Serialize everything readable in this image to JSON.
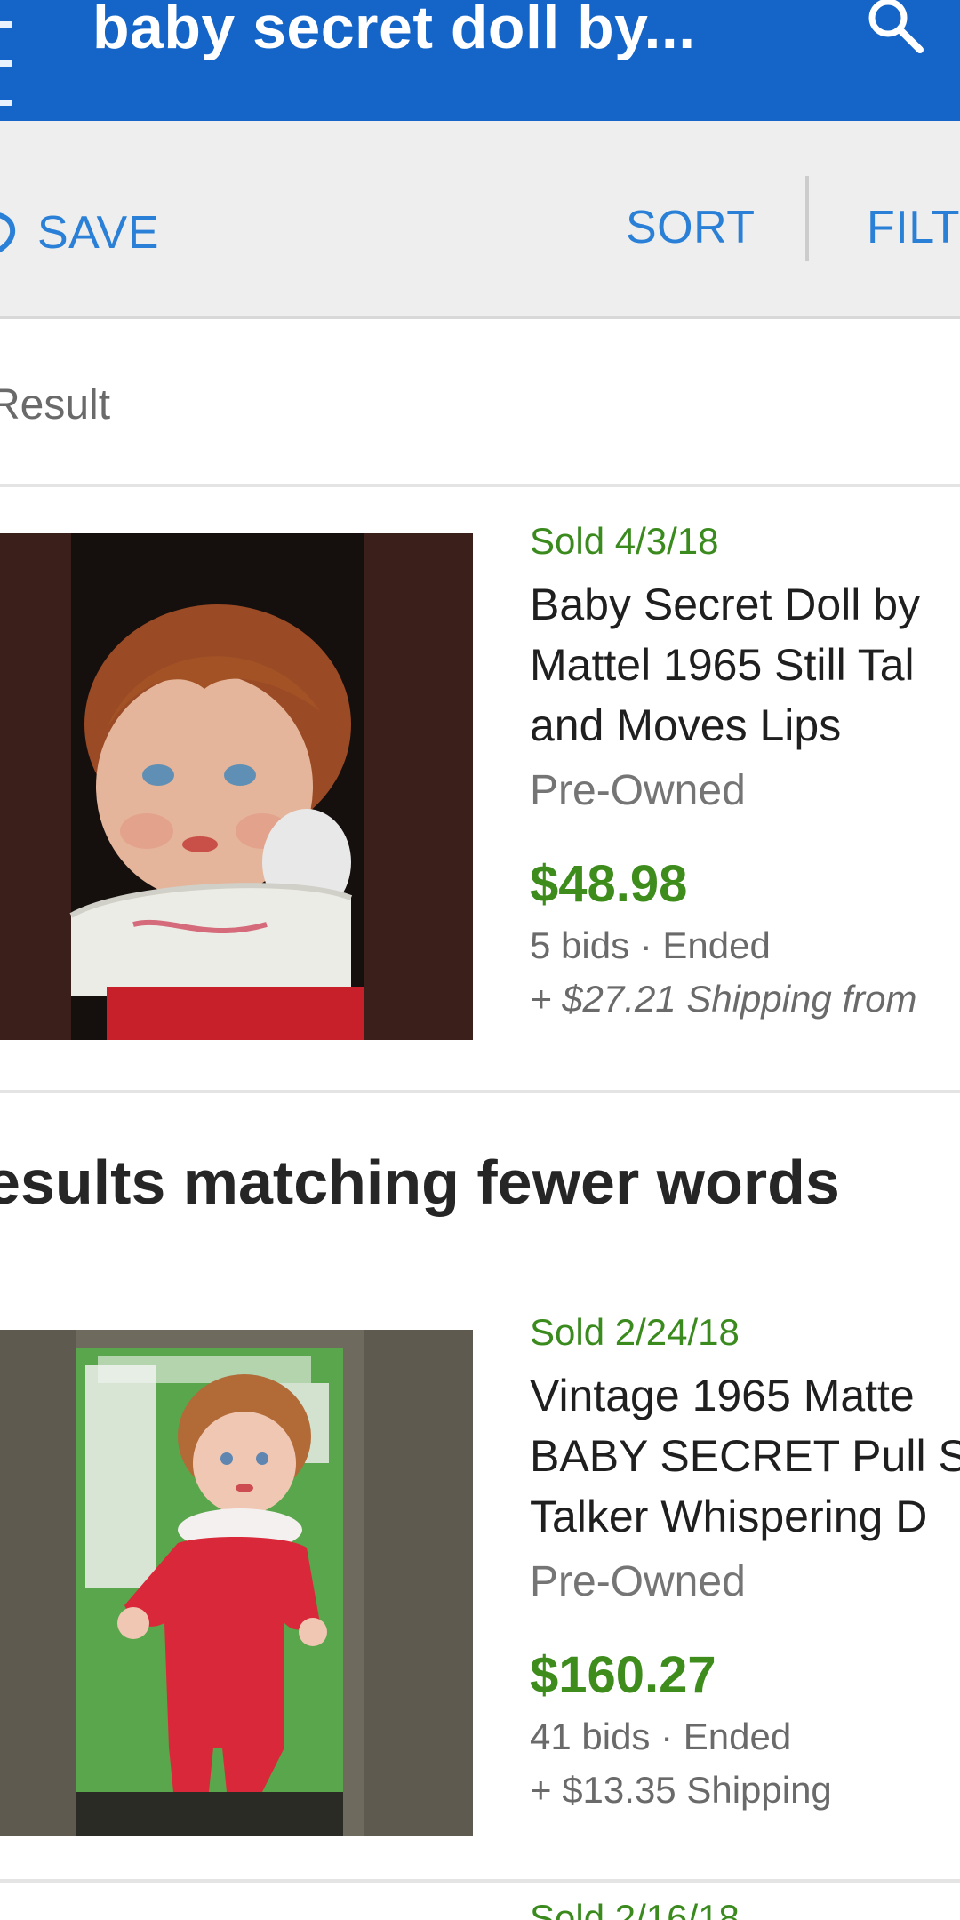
{
  "search": {
    "query": "baby secret doll by..."
  },
  "toolbar": {
    "save_label": "SAVE",
    "sort_label": "SORT",
    "filter_label": "FILT"
  },
  "results": {
    "count_label": "Result"
  },
  "listings": [
    {
      "sold": "Sold 4/3/18",
      "title_lines": [
        "Baby Secret Doll by",
        "Mattel 1965 Still Tal",
        "and Moves Lips"
      ],
      "condition": "Pre-Owned",
      "price": "$48.98",
      "bids": "5 bids · Ended",
      "shipping": "+ $27.21 Shipping from"
    },
    {
      "sold": "Sold 2/24/18",
      "title_lines": [
        "Vintage 1965 Matte",
        "BABY SECRET Pull S",
        "Talker Whispering D"
      ],
      "condition": "Pre-Owned",
      "price": "$160.27",
      "bids": "41 bids · Ended",
      "shipping": "+ $13.35 Shipping"
    }
  ],
  "fewer_words_heading": "esults matching fewer words",
  "next_listing": {
    "sold": "Sold 2/16/18"
  },
  "icons": {
    "menu": "menu-icon",
    "search": "search-icon",
    "save": "heart-icon"
  },
  "colors": {
    "appbar": "#1565c8",
    "link_blue": "#2a7fd6",
    "sold_green": "#3a8a1e",
    "price_green": "#3d8c1c"
  }
}
